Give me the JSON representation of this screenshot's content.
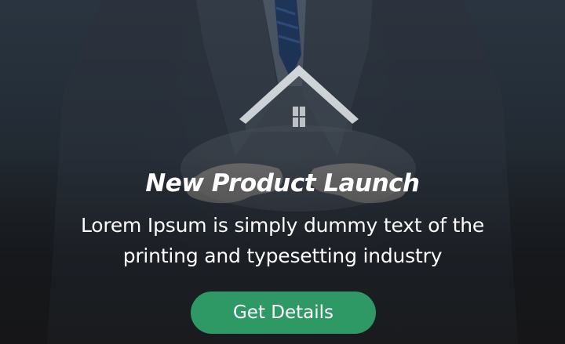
{
  "banner": {
    "headline": "New Product Launch",
    "description": "Lorem Ipsum is simply dummy text of the printing and typesetting industry",
    "cta_label": "Get Details"
  },
  "colors": {
    "cta_background": "#2f9966",
    "text": "#ffffff",
    "background_top": "#2a3440",
    "background_bottom": "#1b1e22"
  },
  "icons": {
    "house": "house-icon"
  }
}
